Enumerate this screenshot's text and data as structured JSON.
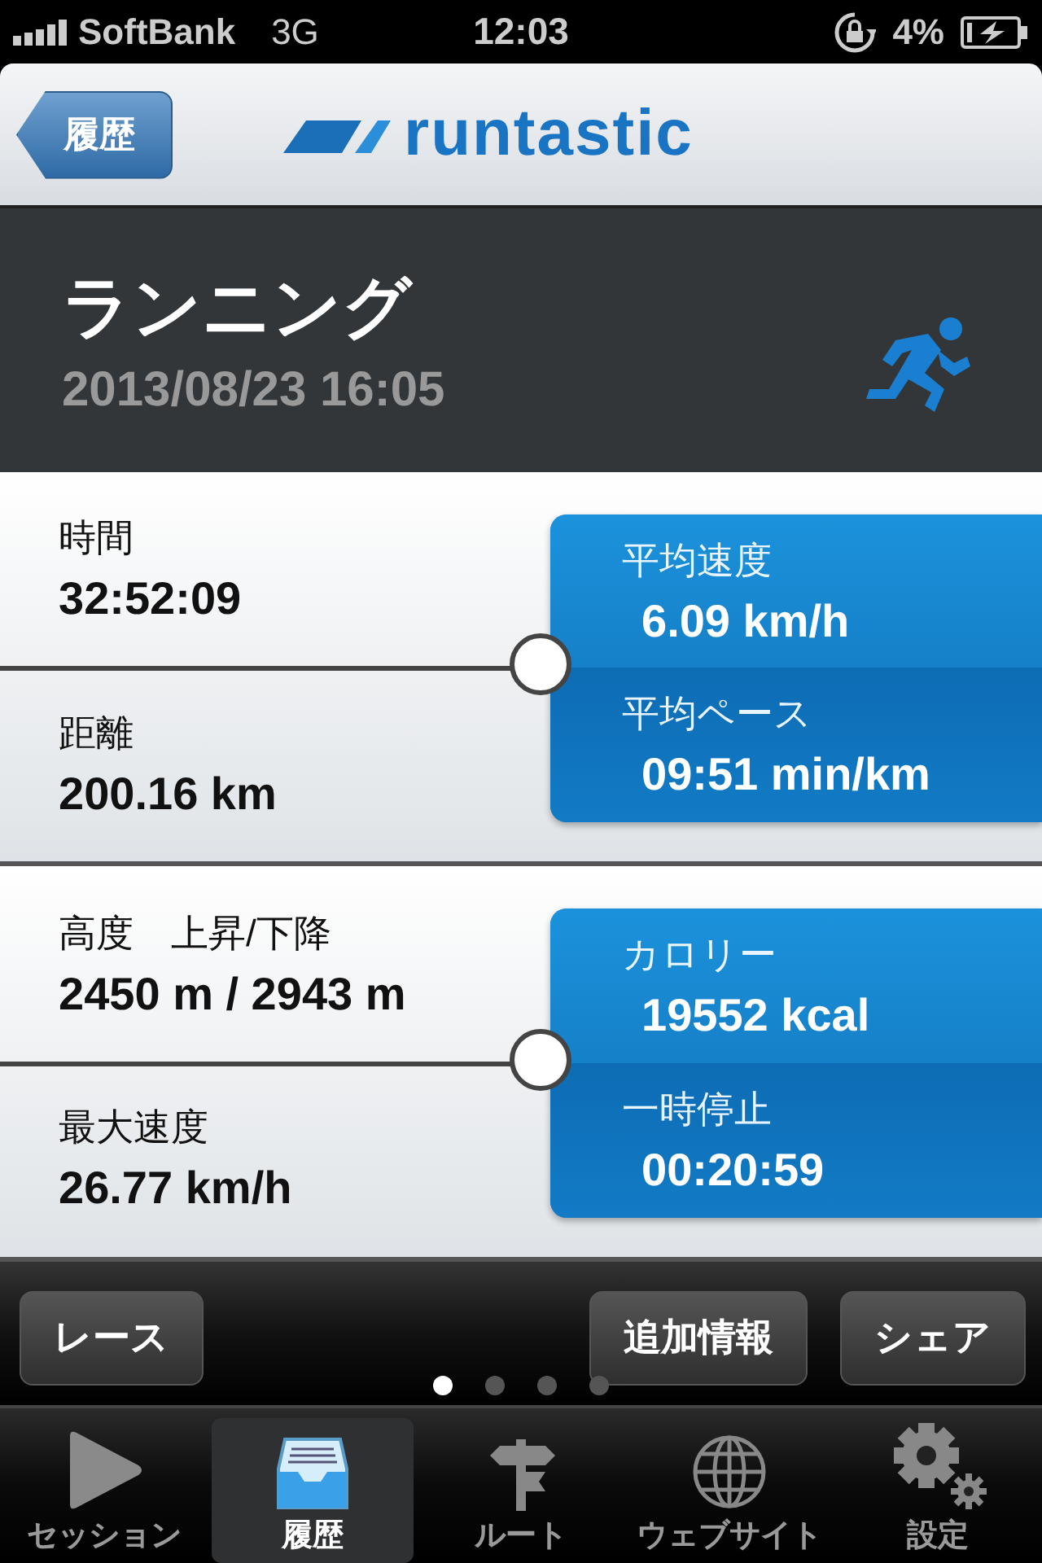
{
  "status_bar": {
    "carrier": "SoftBank",
    "network": "3G",
    "time": "12:03",
    "battery": "4%"
  },
  "nav_bar": {
    "back_button": "履歴",
    "logo": "runtastic"
  },
  "activity": {
    "title": "ランニング",
    "datetime": "2013/08/23 16:05"
  },
  "panels": [
    {
      "left": [
        {
          "label": "時間",
          "value": "32:52:09"
        },
        {
          "label": "距離",
          "value": "200.16 km"
        }
      ],
      "right": [
        {
          "label": "平均速度",
          "value": "6.09 km/h"
        },
        {
          "label": "平均ペース",
          "value": "09:51 min/km"
        }
      ]
    },
    {
      "left": [
        {
          "label": "高度　上昇/下降",
          "value": "2450 m / 2943 m"
        },
        {
          "label": "最大速度",
          "value": "26.77 km/h"
        }
      ],
      "right": [
        {
          "label": "カロリー",
          "value": "19552 kcal"
        },
        {
          "label": "一時停止",
          "value": "00:20:59"
        }
      ]
    }
  ],
  "toolbar": {
    "left_button": "レース",
    "right_buttons": [
      "追加情報",
      "シェア"
    ]
  },
  "pager": [
    {
      "selected": true
    },
    {
      "selected": false
    },
    {
      "selected": false
    },
    {
      "selected": false
    }
  ],
  "tab_bar": [
    {
      "kind": "play",
      "label": "セッション",
      "selected": false
    },
    {
      "kind": "tray",
      "label": "履歴",
      "selected": true
    },
    {
      "kind": "signpost",
      "label": "ルート",
      "selected": false
    },
    {
      "kind": "globe",
      "label": "ウェブサイト",
      "selected": false
    },
    {
      "kind": "gear",
      "label": "設定",
      "selected": false
    }
  ]
}
